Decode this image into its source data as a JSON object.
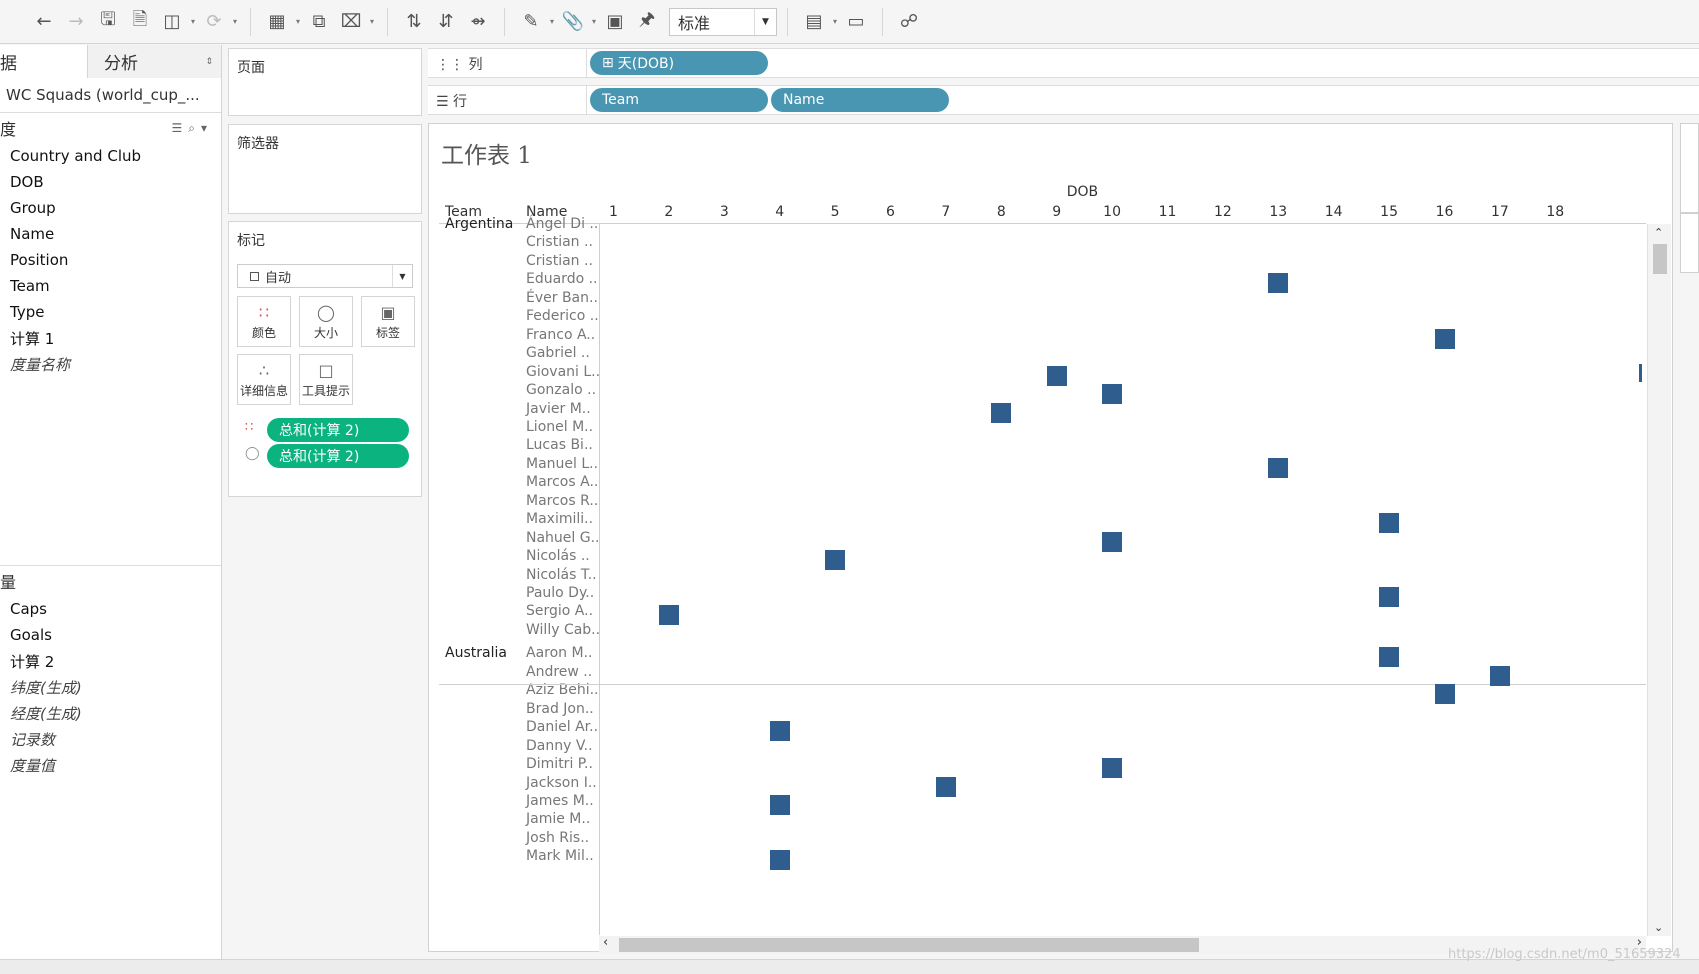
{
  "toolbar": {
    "icons": [
      "back-icon",
      "forward-icon",
      "save-icon",
      "new-datasource-icon",
      "pause-icon",
      "refresh-icon",
      "new-sheet-icon",
      "duplicate-icon",
      "clear-icon",
      "swap-icon",
      "sort-asc-icon",
      "sort-desc-icon",
      "highlight-icon",
      "annotate-icon",
      "label-icon",
      "pin-icon",
      "show-me-icon",
      "presentation-icon",
      "share-icon"
    ],
    "fit_select": "标准"
  },
  "left_pane": {
    "tab_data": "据",
    "tab_analysis": "分析",
    "datasource": "WC Squads (world_cup_...",
    "dimensions_header": "度",
    "dimensions": [
      "Country and Club",
      "DOB",
      "Group",
      "Name",
      "Position",
      "Team",
      "Type",
      "计算 1"
    ],
    "dimensions_generated": [
      "度量名称"
    ],
    "measures_header": "量",
    "measures": [
      "Caps",
      "Goals",
      "计算 2"
    ],
    "measures_generated": [
      "纬度(生成)",
      "经度(生成)",
      "记录数",
      "度量值"
    ]
  },
  "cards": {
    "pages_title": "页面",
    "filters_title": "筛选器",
    "marks_title": "标记",
    "mark_type": "自动",
    "mark_buttons": [
      {
        "label": "颜色",
        "icon": "color-dots-icon"
      },
      {
        "label": "大小",
        "icon": "size-icon"
      },
      {
        "label": "标签",
        "icon": "text-label-icon"
      },
      {
        "label": "详细信息",
        "icon": "detail-icon"
      },
      {
        "label": "工具提示",
        "icon": "tooltip-icon"
      }
    ],
    "mark_pills": [
      "总和(计算 2)",
      "总和(计算 2)"
    ]
  },
  "shelves": {
    "columns_label": "列",
    "rows_label": "行",
    "column_pills": [
      "天(DOB)"
    ],
    "row_pills": [
      "Team",
      "Name"
    ]
  },
  "sheet": {
    "title": "工作表 1",
    "col_header_team": "Team",
    "col_header_name": "Name",
    "axis_title": "DOB",
    "days": [
      1,
      2,
      3,
      4,
      5,
      6,
      7,
      8,
      9,
      10,
      11,
      12,
      13,
      14,
      15,
      16,
      17,
      18
    ],
    "teams": [
      {
        "team": "Argentina",
        "rows": [
          {
            "name": "Ángel Di ..",
            "day": null
          },
          {
            "name": "Cristian ..",
            "day": null
          },
          {
            "name": "Cristian ..",
            "day": null
          },
          {
            "name": "Eduardo ..",
            "day": 13
          },
          {
            "name": "Éver Ban..",
            "day": null
          },
          {
            "name": "Federico ..",
            "day": null
          },
          {
            "name": "Franco A..",
            "day": 16
          },
          {
            "name": "Gabriel ..",
            "day": null
          },
          {
            "name": "Giovani L..",
            "day": 9
          },
          {
            "name": "Gonzalo ..",
            "day": 10
          },
          {
            "name": "Javier M..",
            "day": 8
          },
          {
            "name": "Lionel M..",
            "day": null
          },
          {
            "name": "Lucas Bi..",
            "day": null
          },
          {
            "name": "Manuel L..",
            "day": 13
          },
          {
            "name": "Marcos A..",
            "day": null
          },
          {
            "name": "Marcos R..",
            "day": null
          },
          {
            "name": "Maximili..",
            "day": 15
          },
          {
            "name": "Nahuel G..",
            "day": 10
          },
          {
            "name": "Nicolás ..",
            "day": 5
          },
          {
            "name": "Nicolás T..",
            "day": null
          },
          {
            "name": "Paulo Dy..",
            "day": 15
          },
          {
            "name": "Sergio A..",
            "day": 2
          },
          {
            "name": "Willy Cab..",
            "day": null
          }
        ]
      },
      {
        "team": "Australia",
        "rows": [
          {
            "name": "Aaron M..",
            "day": 15
          },
          {
            "name": "Andrew ..",
            "day": 17
          },
          {
            "name": "Aziz Behi..",
            "day": 16
          },
          {
            "name": "Brad Jon..",
            "day": null
          },
          {
            "name": "Daniel Ar..",
            "day": 4
          },
          {
            "name": "Danny V..",
            "day": null
          },
          {
            "name": "Dimitri P..",
            "day": 10
          },
          {
            "name": "Jackson I..",
            "day": 7
          },
          {
            "name": "James M..",
            "day": 4
          },
          {
            "name": "Jamie M..",
            "day": null
          },
          {
            "name": "Josh Ris..",
            "day": null
          },
          {
            "name": "Mark Mil..",
            "day": 4
          }
        ]
      }
    ]
  },
  "watermark": "https://blog.csdn.net/m0_51659324"
}
